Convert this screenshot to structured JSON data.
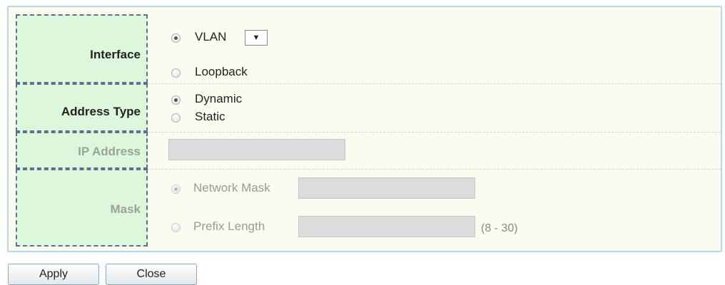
{
  "form": {
    "interface": {
      "label": "Interface",
      "options": [
        {
          "label": "VLAN",
          "selected": true
        },
        {
          "label": "Loopback",
          "selected": false
        }
      ],
      "vlan_select": {
        "value": "",
        "icon": "chevron-down-icon",
        "glyph": "▼"
      }
    },
    "address_type": {
      "label": "Address Type",
      "options": [
        {
          "label": "Dynamic",
          "selected": true
        },
        {
          "label": "Static",
          "selected": false
        }
      ]
    },
    "ip_address": {
      "label": "IP Address",
      "value": "",
      "disabled": true
    },
    "mask": {
      "label": "Mask",
      "disabled": true,
      "options": [
        {
          "label": "Network Mask",
          "selected": true,
          "value": ""
        },
        {
          "label": "Prefix Length",
          "selected": false,
          "value": "",
          "hint": "(8 - 30)"
        }
      ]
    }
  },
  "buttons": {
    "apply": "Apply",
    "close": "Close"
  },
  "colors": {
    "label_bg": "#ddf7dd",
    "panel_bg": "#fcfbef",
    "panel_border": "#b7d6ec",
    "disabled_text": "#9a9a9a"
  }
}
